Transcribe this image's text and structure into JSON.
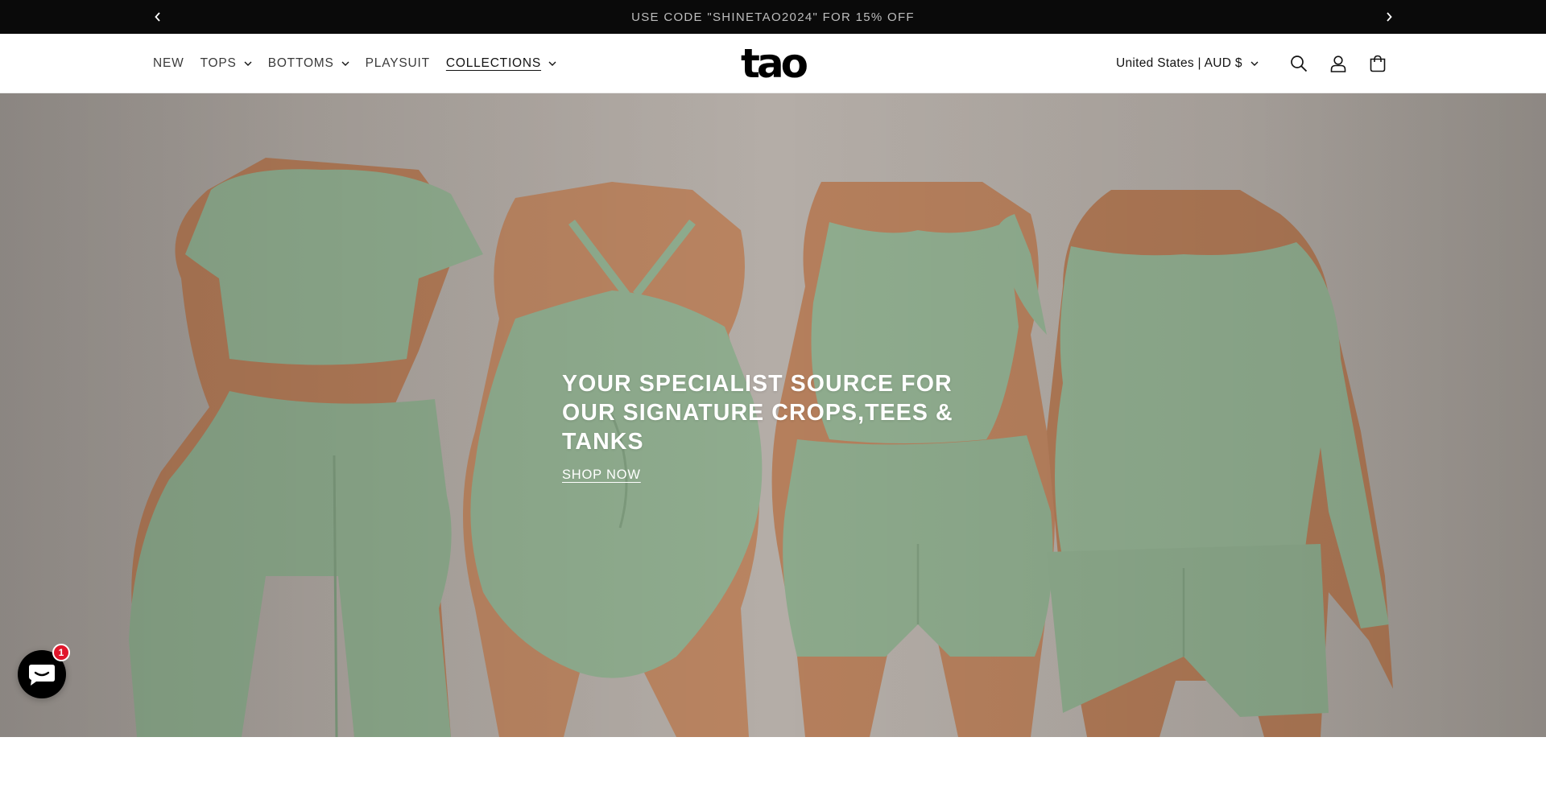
{
  "announcement": {
    "text": "USE CODE \"SHINETAO2024\" FOR 15% OFF",
    "prev_icon": "chevron-left-icon",
    "next_icon": "chevron-right-icon"
  },
  "header": {
    "nav": [
      {
        "label": "NEW",
        "has_dropdown": false
      },
      {
        "label": "TOPS",
        "has_dropdown": true
      },
      {
        "label": "BOTTOMS",
        "has_dropdown": true
      },
      {
        "label": "PLAYSUIT",
        "has_dropdown": false
      },
      {
        "label": "COLLECTIONS",
        "has_dropdown": true,
        "active": true
      }
    ],
    "logo": "tao",
    "locale": "United States | AUD $",
    "icons": [
      "search-icon",
      "account-icon",
      "cart-icon"
    ]
  },
  "hero": {
    "title": "YOUR SPECIALIST SOURCE FOR OUR SIGNATURE CROPS,TEES & TANKS",
    "cta": "SHOP NOW",
    "garment_color": "#8fac8e",
    "skin_color": "#b5805e",
    "background_color": "#aca59f"
  },
  "chat": {
    "icon": "chat-icon",
    "badge": "1",
    "badge_color": "#e0162b"
  }
}
